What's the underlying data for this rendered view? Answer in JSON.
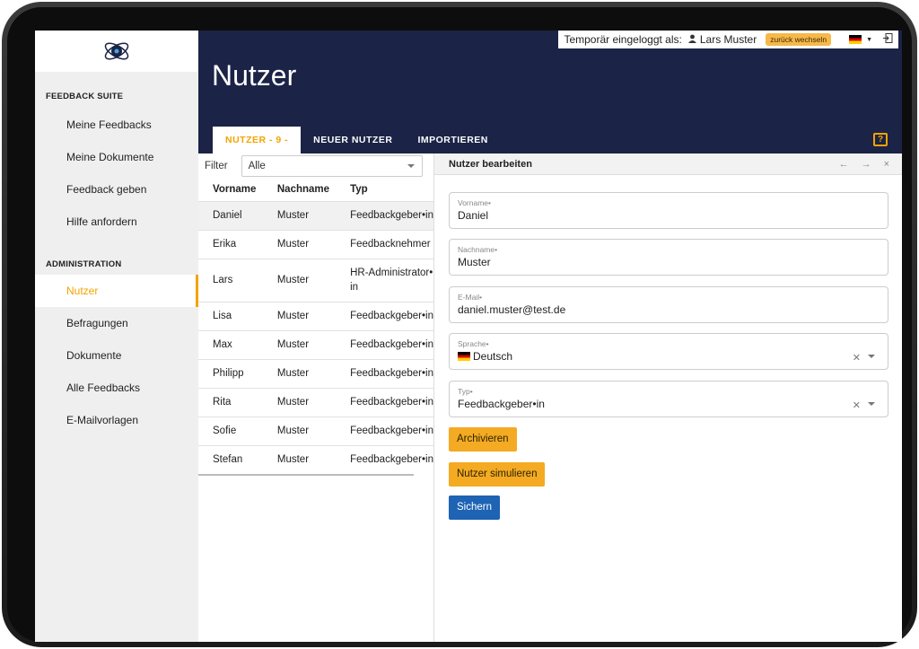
{
  "sidebar": {
    "sections": [
      {
        "title": "FEEDBACK SUITE",
        "items": [
          "Meine Feedbacks",
          "Meine Dokumente",
          "Feedback geben",
          "Hilfe anfordern"
        ]
      },
      {
        "title": "ADMINISTRATION",
        "items": [
          "Nutzer",
          "Befragungen",
          "Dokumente",
          "Alle Feedbacks",
          "E-Mailvorlagen"
        ]
      }
    ],
    "active_item": "Nutzer"
  },
  "header": {
    "title": "Nutzer",
    "temp_login_label": "Temporär eingeloggt als:",
    "temp_user": "Lars Muster",
    "switch_back": "zurück wechseln",
    "tabs": [
      "NUTZER - 9 -",
      "NEUER NUTZER",
      "IMPORTIEREN"
    ],
    "active_tab": "NUTZER - 9 -",
    "help_icon": "?"
  },
  "list": {
    "filter_label": "Filter",
    "filter_value": "Alle",
    "columns": [
      "Vorname",
      "Nachname",
      "Typ"
    ],
    "rows": [
      [
        "Daniel",
        "Muster",
        "Feedbackgeber•in"
      ],
      [
        "Erika",
        "Muster",
        "Feedbacknehmer"
      ],
      [
        "Lars",
        "Muster",
        "HR-Administrator•in"
      ],
      [
        "Lisa",
        "Muster",
        "Feedbackgeber•in"
      ],
      [
        "Max",
        "Muster",
        "Feedbackgeber•in"
      ],
      [
        "Philipp",
        "Muster",
        "Feedbackgeber•in"
      ],
      [
        "Rita",
        "Muster",
        "Feedbackgeber•in"
      ],
      [
        "Sofie",
        "Muster",
        "Feedbackgeber•in"
      ],
      [
        "Stefan",
        "Muster",
        "Feedbackgeber•in"
      ]
    ],
    "selected_row": 0
  },
  "edit": {
    "title": "Nutzer bearbeiten",
    "fields": [
      {
        "label": "Vorname•",
        "value": "Daniel"
      },
      {
        "label": "Nachname•",
        "value": "Muster"
      },
      {
        "label": "E-Mail•",
        "value": "daniel.muster@test.de"
      },
      {
        "label": "Sprache•",
        "value": "Deutsch"
      },
      {
        "label": "Typ•",
        "value": "Feedbackgeber•in"
      }
    ],
    "buttons": {
      "archive": "Archivieren",
      "simulate": "Nutzer simulieren",
      "save": "Sichern"
    },
    "nav": {
      "prev": "←",
      "next": "→",
      "close": "×"
    }
  },
  "colors": {
    "navy": "#1b2346",
    "accent": "#f4a300",
    "save": "#1e63b4"
  }
}
